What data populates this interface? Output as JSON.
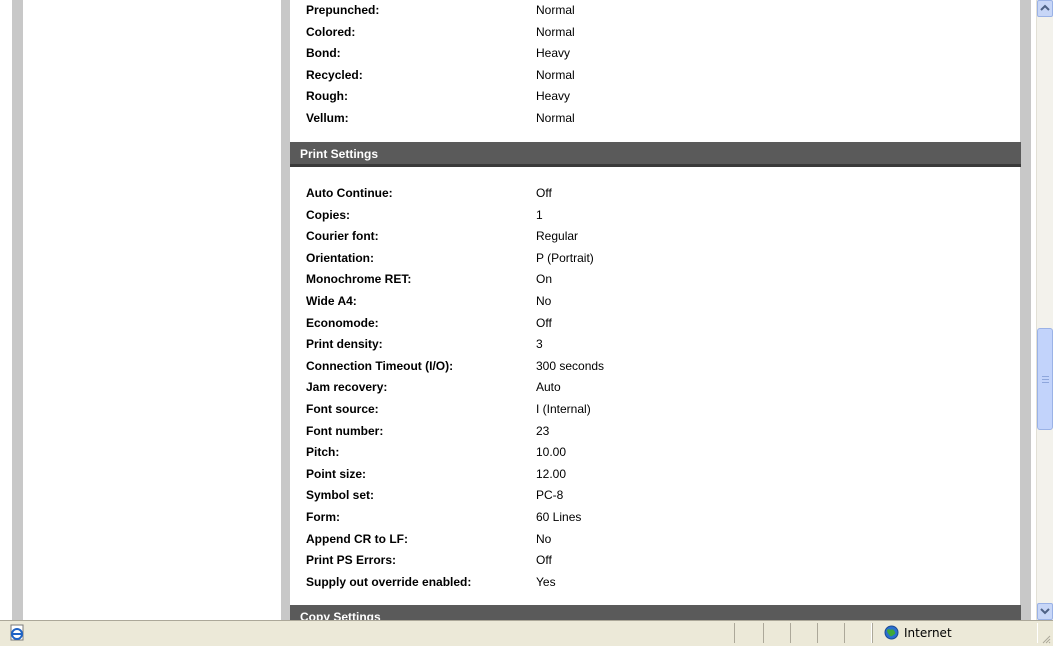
{
  "paper_rows": [
    {
      "label": "Prepunched:",
      "value": "Normal"
    },
    {
      "label": "Colored:",
      "value": "Normal"
    },
    {
      "label": "Bond:",
      "value": "Heavy"
    },
    {
      "label": "Recycled:",
      "value": "Normal"
    },
    {
      "label": "Rough:",
      "value": "Heavy"
    },
    {
      "label": "Vellum:",
      "value": "Normal"
    }
  ],
  "print_settings": {
    "title": "Print Settings",
    "rows": [
      {
        "label": "Auto Continue:",
        "value": "Off"
      },
      {
        "label": "Copies:",
        "value": "1"
      },
      {
        "label": "Courier font:",
        "value": "Regular"
      },
      {
        "label": "Orientation:",
        "value": "P (Portrait)"
      },
      {
        "label": "Monochrome RET:",
        "value": "On"
      },
      {
        "label": "Wide A4:",
        "value": "No"
      },
      {
        "label": "Economode:",
        "value": "Off"
      },
      {
        "label": "Print density:",
        "value": "3"
      },
      {
        "label": "Connection Timeout (I/O):",
        "value": "300 seconds"
      },
      {
        "label": "Jam recovery:",
        "value": "Auto"
      },
      {
        "label": "Font source:",
        "value": "I (Internal)"
      },
      {
        "label": "Font number:",
        "value": "23"
      },
      {
        "label": "Pitch:",
        "value": "10.00"
      },
      {
        "label": "Point size:",
        "value": "12.00"
      },
      {
        "label": "Symbol set:",
        "value": "PC-8"
      },
      {
        "label": "Form:",
        "value": "60 Lines"
      },
      {
        "label": "Append CR to LF:",
        "value": "No"
      },
      {
        "label": "Print PS Errors:",
        "value": "Off"
      },
      {
        "label": "Supply out override enabled:",
        "value": "Yes"
      }
    ]
  },
  "copy_settings": {
    "title": "Copy Settings"
  },
  "statusbar": {
    "zone": "Internet",
    "page_icon": "ie-page-icon",
    "zone_icon": "globe-icon"
  },
  "colors": {
    "section_header": "#5a5a5a",
    "frame_gray": "#c8c8c8",
    "statusbar_bg": "#ece9d8",
    "scroll_accent": "#c2d3fb"
  }
}
